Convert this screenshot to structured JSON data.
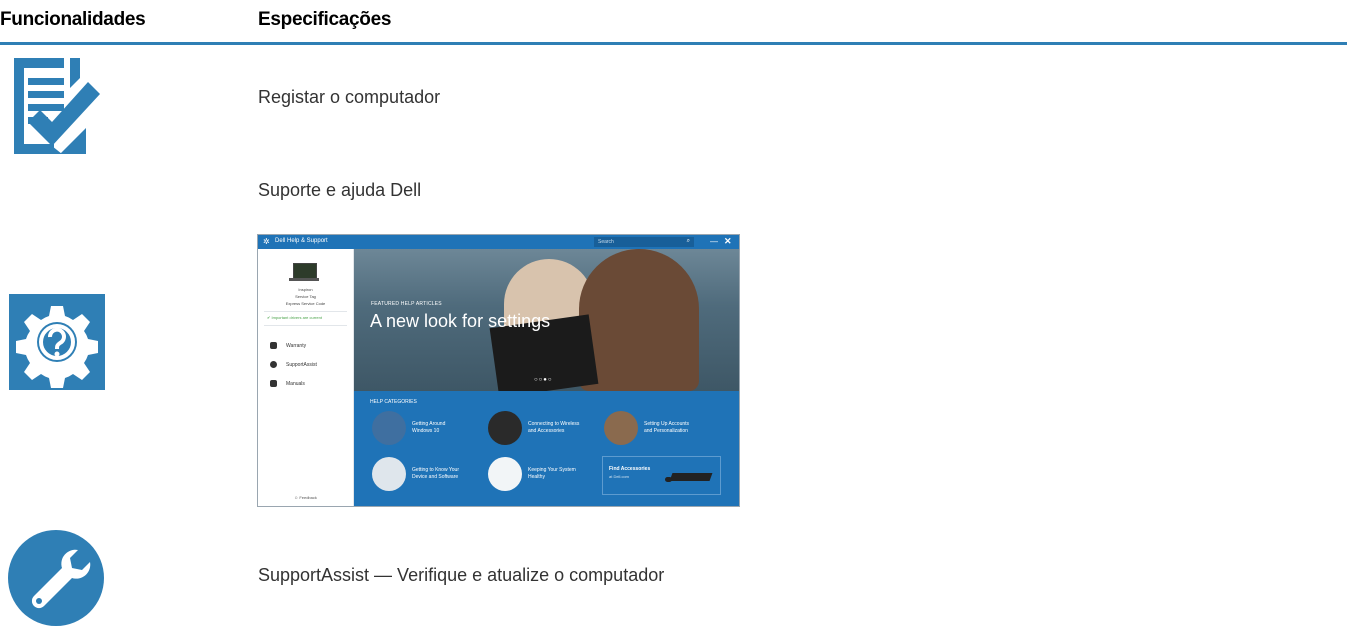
{
  "header": {
    "col1": "Funcionalidades",
    "col2": "Especificações"
  },
  "accent": "#2f7fb5",
  "rows": [
    {
      "icon": "checklist-icon",
      "text": "Registar o computador"
    },
    {
      "icon": "help-gear-icon",
      "text": "Suporte e ajuda Dell"
    },
    {
      "icon": "wrench-icon",
      "text": "SupportAssist — Verifique e atualize o computador"
    }
  ],
  "screenshot": {
    "window_title": "Dell Help & Support",
    "search_placeholder": "Search",
    "sidebar": {
      "model": "Inspiron",
      "service_tag": "Service Tag",
      "express_code": "Express Service Code",
      "drivers_status": "Important drivers are current",
      "items": [
        "Warranty",
        "SupportAssist",
        "Manuals"
      ],
      "feedback": "Feedback"
    },
    "hero": {
      "kicker": "FEATURED HELP ARTICLES",
      "title": "A new look for settings"
    },
    "categories_title": "HELP CATEGORIES",
    "categories": [
      {
        "line1": "Getting Around",
        "line2": "Windows 10"
      },
      {
        "line1": "Connecting to Wireless",
        "line2": "and Accessories"
      },
      {
        "line1": "Setting Up Accounts",
        "line2": "and Personalization"
      },
      {
        "line1": "Getting to Know Your",
        "line2": "Device and Software"
      },
      {
        "line1": "Keeping Your System",
        "line2": "Healthy"
      }
    ],
    "accessories": {
      "title": "Find Accessories",
      "subtitle": "at Dell.com"
    }
  }
}
